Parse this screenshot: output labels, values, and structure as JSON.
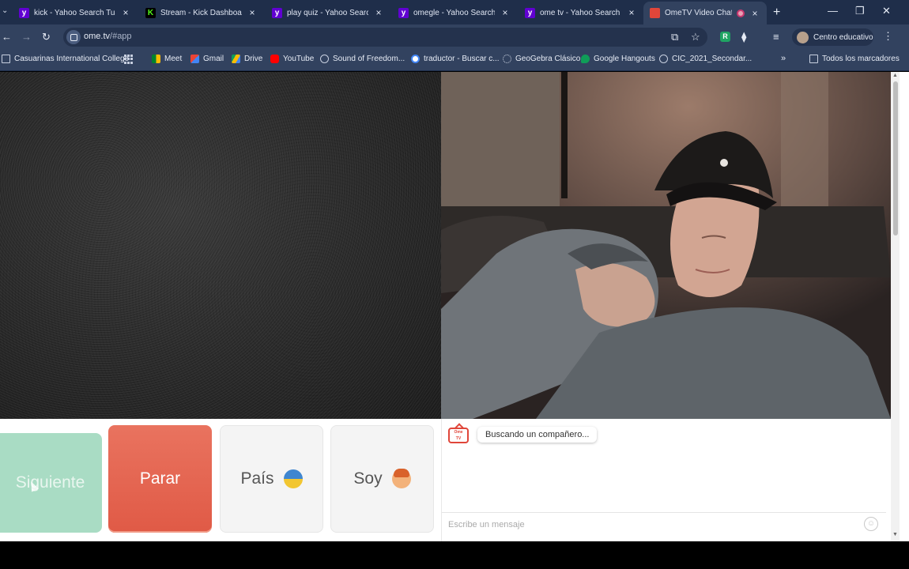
{
  "tabs": [
    {
      "title": "kick - Yahoo Search Tus resultados",
      "icon": "yahoo-icon",
      "color": "#6001d2"
    },
    {
      "title": "Stream - Kick Dashboard",
      "icon": "kick-icon",
      "color": "#53fc18"
    },
    {
      "title": "play quiz - Yahoo Search Tus resultados",
      "icon": "yahoo-icon",
      "color": "#6001d2"
    },
    {
      "title": "omegle - Yahoo Search Tus resultados",
      "icon": "yahoo-icon",
      "color": "#6001d2"
    },
    {
      "title": "ome tv - Yahoo Search Tus resultados",
      "icon": "yahoo-icon",
      "color": "#6001d2"
    },
    {
      "title": "OmeTV Video Chat — ",
      "icon": "ometv-icon",
      "color": "#e0463a",
      "active": true
    }
  ],
  "toolbar": {
    "url_host": "ome.tv",
    "url_path": "/#app",
    "profile_name": "Centro educativo"
  },
  "bookmarks": [
    {
      "label": "Casuarinas International College",
      "icon": "folder-icon"
    },
    {
      "label": "Meet",
      "icon": "meet-icon"
    },
    {
      "label": "Gmail",
      "icon": "gmail-icon"
    },
    {
      "label": "Drive",
      "icon": "drive-icon"
    },
    {
      "label": "YouTube",
      "icon": "youtube-icon"
    },
    {
      "label": "Sound of Freedom...",
      "icon": "globe-icon"
    },
    {
      "label": "traductor - Buscar c...",
      "icon": "google-icon"
    },
    {
      "label": "GeoGebra Clásico",
      "icon": "geogebra-icon"
    },
    {
      "label": "Google Hangouts",
      "icon": "hangouts-icon"
    },
    {
      "label": "CIC_2021_Secondar...",
      "icon": "globe-icon"
    }
  ],
  "all_bookmarks_label": "Todos los marcadores",
  "controls": {
    "next_label": "Siguiente",
    "stop_label": "Parar",
    "country_label": "País",
    "country_flag": "ukraine-flag-icon",
    "me_label": "Soy",
    "me_icon": "boy-emoji-icon"
  },
  "chat": {
    "status_message": "Buscando un compañero...",
    "input_placeholder": "Escribe un mensaje"
  },
  "colors": {
    "next_button": "#a9dcc4",
    "stop_button": "#e05a46",
    "browser_frame": "#32425f"
  }
}
